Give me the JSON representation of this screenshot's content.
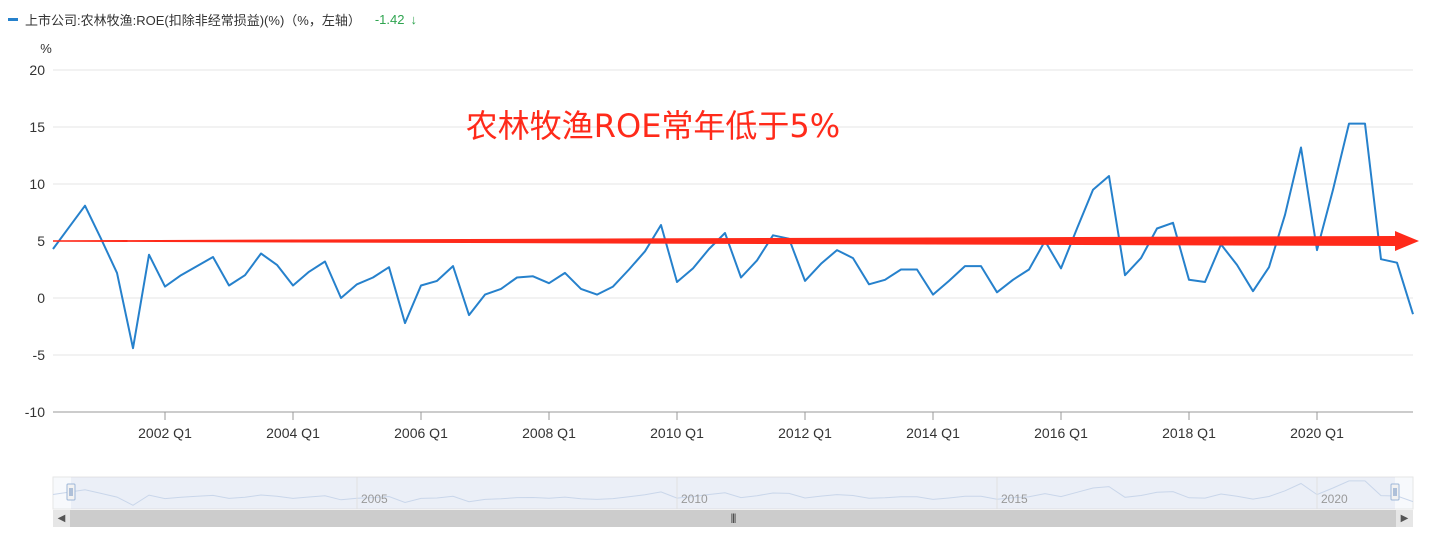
{
  "legend": {
    "label": "上市公司:农林牧渔:ROE(扣除非经常损益)(%)（%，左轴）",
    "last_value": "-1.42",
    "trend_icon": "arrow-down-icon",
    "series_color": "#2681cc",
    "value_color": "#2ea44f"
  },
  "annotation": {
    "text": "农林牧渔ROE常年低于5%",
    "color": "#ff2a1a",
    "arrow_level": 5
  },
  "navigator": {
    "year_labels": [
      "2005",
      "2010",
      "2015",
      "2020"
    ],
    "handle_icon": "navigator-handle-icon"
  },
  "chart_data": {
    "type": "line",
    "ylabel": "%",
    "ylim": [
      -10,
      20
    ],
    "yticks": [
      -10,
      -5,
      0,
      5,
      10,
      15,
      20
    ],
    "xtick_labels": [
      "2002 Q1",
      "2004 Q1",
      "2006 Q1",
      "2008 Q1",
      "2010 Q1",
      "2012 Q1",
      "2014 Q1",
      "2016 Q1",
      "2018 Q1",
      "2020 Q1"
    ],
    "start_period": "2000 Q2",
    "grid": true,
    "series": [
      {
        "name": "上市公司:农林牧渔:ROE(扣除非经常损益)(%)",
        "color": "#2681cc",
        "values": [
          4.3,
          6.2,
          8.1,
          5.2,
          2.2,
          -4.4,
          3.8,
          1.0,
          2.0,
          2.8,
          3.6,
          1.1,
          2.0,
          3.9,
          2.9,
          1.1,
          2.3,
          3.2,
          0.0,
          1.2,
          1.8,
          2.7,
          -2.2,
          1.1,
          1.5,
          2.8,
          -1.5,
          0.3,
          0.8,
          1.8,
          1.9,
          1.3,
          2.2,
          0.8,
          0.3,
          1.0,
          2.5,
          4.1,
          6.4,
          1.4,
          2.6,
          4.3,
          5.7,
          1.8,
          3.3,
          5.5,
          5.2,
          1.5,
          3.0,
          4.2,
          3.5,
          1.2,
          1.6,
          2.5,
          2.5,
          0.3,
          1.5,
          2.8,
          2.8,
          0.5,
          1.6,
          2.5,
          5.0,
          2.6,
          6.1,
          9.5,
          10.7,
          2.0,
          3.5,
          6.1,
          6.6,
          1.6,
          1.4,
          4.7,
          2.9,
          0.6,
          2.7,
          7.3,
          13.2,
          4.2,
          9.5,
          15.3,
          15.3,
          3.4,
          3.1,
          -1.42
        ]
      }
    ]
  }
}
